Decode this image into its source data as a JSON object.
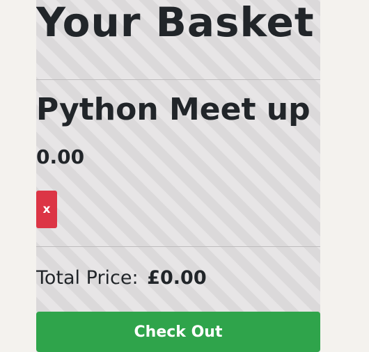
{
  "basket": {
    "title": "Your Basket",
    "items": [
      {
        "name": "Python Meet up",
        "price": "0.00",
        "remove_label": "x"
      }
    ],
    "total_label": "Total Price:",
    "total_value": "£0.00",
    "checkout_label": "Check Out"
  },
  "colors": {
    "remove_button": "#dc3545",
    "checkout_button": "#2fa44b",
    "page_background": "#f4f2ee",
    "panel_background": "#e4e2e3"
  }
}
